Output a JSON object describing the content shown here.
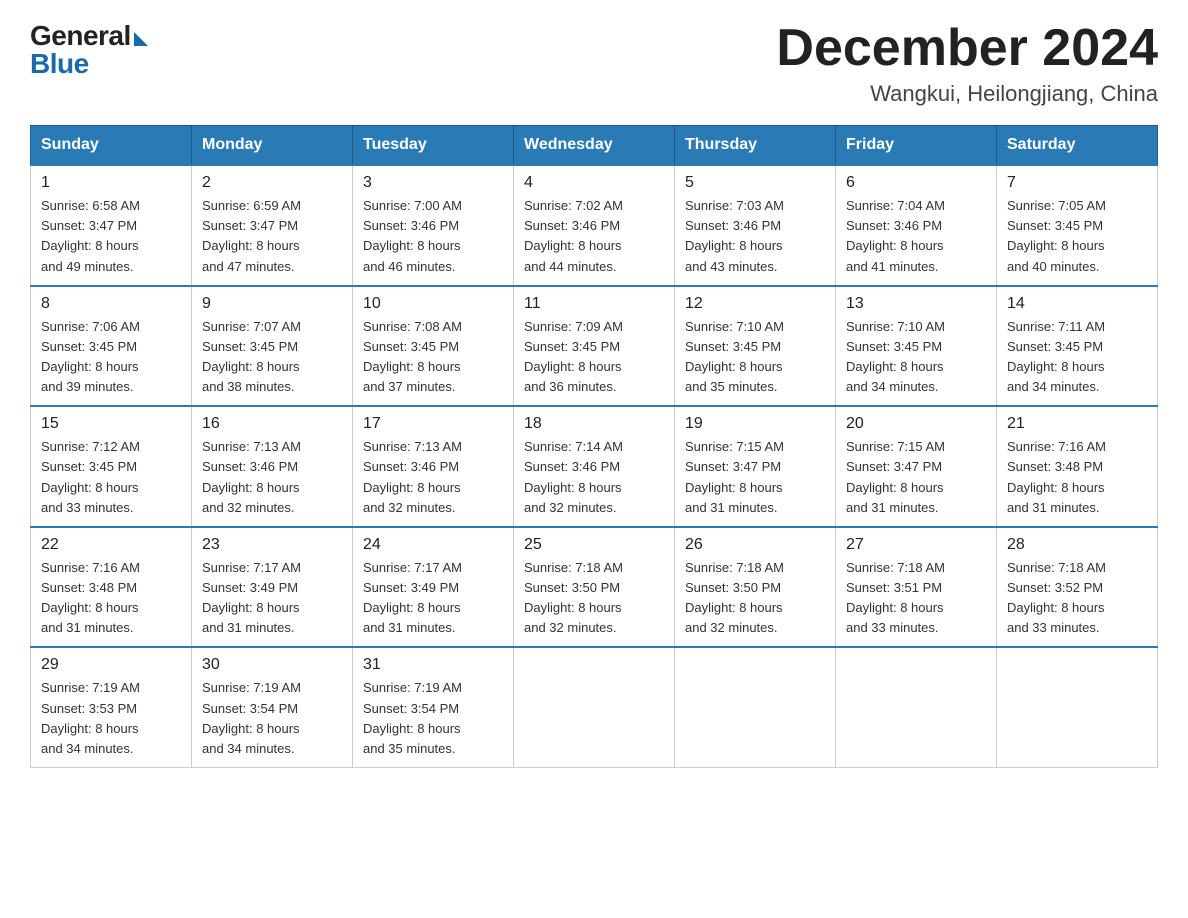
{
  "header": {
    "logo_general": "General",
    "logo_blue": "Blue",
    "title": "December 2024",
    "location": "Wangkui, Heilongjiang, China"
  },
  "days_of_week": [
    "Sunday",
    "Monday",
    "Tuesday",
    "Wednesday",
    "Thursday",
    "Friday",
    "Saturday"
  ],
  "weeks": [
    [
      {
        "day": "1",
        "sunrise": "6:58 AM",
        "sunset": "3:47 PM",
        "daylight": "8 hours and 49 minutes."
      },
      {
        "day": "2",
        "sunrise": "6:59 AM",
        "sunset": "3:47 PM",
        "daylight": "8 hours and 47 minutes."
      },
      {
        "day": "3",
        "sunrise": "7:00 AM",
        "sunset": "3:46 PM",
        "daylight": "8 hours and 46 minutes."
      },
      {
        "day": "4",
        "sunrise": "7:02 AM",
        "sunset": "3:46 PM",
        "daylight": "8 hours and 44 minutes."
      },
      {
        "day": "5",
        "sunrise": "7:03 AM",
        "sunset": "3:46 PM",
        "daylight": "8 hours and 43 minutes."
      },
      {
        "day": "6",
        "sunrise": "7:04 AM",
        "sunset": "3:46 PM",
        "daylight": "8 hours and 41 minutes."
      },
      {
        "day": "7",
        "sunrise": "7:05 AM",
        "sunset": "3:45 PM",
        "daylight": "8 hours and 40 minutes."
      }
    ],
    [
      {
        "day": "8",
        "sunrise": "7:06 AM",
        "sunset": "3:45 PM",
        "daylight": "8 hours and 39 minutes."
      },
      {
        "day": "9",
        "sunrise": "7:07 AM",
        "sunset": "3:45 PM",
        "daylight": "8 hours and 38 minutes."
      },
      {
        "day": "10",
        "sunrise": "7:08 AM",
        "sunset": "3:45 PM",
        "daylight": "8 hours and 37 minutes."
      },
      {
        "day": "11",
        "sunrise": "7:09 AM",
        "sunset": "3:45 PM",
        "daylight": "8 hours and 36 minutes."
      },
      {
        "day": "12",
        "sunrise": "7:10 AM",
        "sunset": "3:45 PM",
        "daylight": "8 hours and 35 minutes."
      },
      {
        "day": "13",
        "sunrise": "7:10 AM",
        "sunset": "3:45 PM",
        "daylight": "8 hours and 34 minutes."
      },
      {
        "day": "14",
        "sunrise": "7:11 AM",
        "sunset": "3:45 PM",
        "daylight": "8 hours and 34 minutes."
      }
    ],
    [
      {
        "day": "15",
        "sunrise": "7:12 AM",
        "sunset": "3:45 PM",
        "daylight": "8 hours and 33 minutes."
      },
      {
        "day": "16",
        "sunrise": "7:13 AM",
        "sunset": "3:46 PM",
        "daylight": "8 hours and 32 minutes."
      },
      {
        "day": "17",
        "sunrise": "7:13 AM",
        "sunset": "3:46 PM",
        "daylight": "8 hours and 32 minutes."
      },
      {
        "day": "18",
        "sunrise": "7:14 AM",
        "sunset": "3:46 PM",
        "daylight": "8 hours and 32 minutes."
      },
      {
        "day": "19",
        "sunrise": "7:15 AM",
        "sunset": "3:47 PM",
        "daylight": "8 hours and 31 minutes."
      },
      {
        "day": "20",
        "sunrise": "7:15 AM",
        "sunset": "3:47 PM",
        "daylight": "8 hours and 31 minutes."
      },
      {
        "day": "21",
        "sunrise": "7:16 AM",
        "sunset": "3:48 PM",
        "daylight": "8 hours and 31 minutes."
      }
    ],
    [
      {
        "day": "22",
        "sunrise": "7:16 AM",
        "sunset": "3:48 PM",
        "daylight": "8 hours and 31 minutes."
      },
      {
        "day": "23",
        "sunrise": "7:17 AM",
        "sunset": "3:49 PM",
        "daylight": "8 hours and 31 minutes."
      },
      {
        "day": "24",
        "sunrise": "7:17 AM",
        "sunset": "3:49 PM",
        "daylight": "8 hours and 31 minutes."
      },
      {
        "day": "25",
        "sunrise": "7:18 AM",
        "sunset": "3:50 PM",
        "daylight": "8 hours and 32 minutes."
      },
      {
        "day": "26",
        "sunrise": "7:18 AM",
        "sunset": "3:50 PM",
        "daylight": "8 hours and 32 minutes."
      },
      {
        "day": "27",
        "sunrise": "7:18 AM",
        "sunset": "3:51 PM",
        "daylight": "8 hours and 33 minutes."
      },
      {
        "day": "28",
        "sunrise": "7:18 AM",
        "sunset": "3:52 PM",
        "daylight": "8 hours and 33 minutes."
      }
    ],
    [
      {
        "day": "29",
        "sunrise": "7:19 AM",
        "sunset": "3:53 PM",
        "daylight": "8 hours and 34 minutes."
      },
      {
        "day": "30",
        "sunrise": "7:19 AM",
        "sunset": "3:54 PM",
        "daylight": "8 hours and 34 minutes."
      },
      {
        "day": "31",
        "sunrise": "7:19 AM",
        "sunset": "3:54 PM",
        "daylight": "8 hours and 35 minutes."
      },
      null,
      null,
      null,
      null
    ]
  ],
  "labels": {
    "sunrise": "Sunrise:",
    "sunset": "Sunset:",
    "daylight": "Daylight:"
  }
}
